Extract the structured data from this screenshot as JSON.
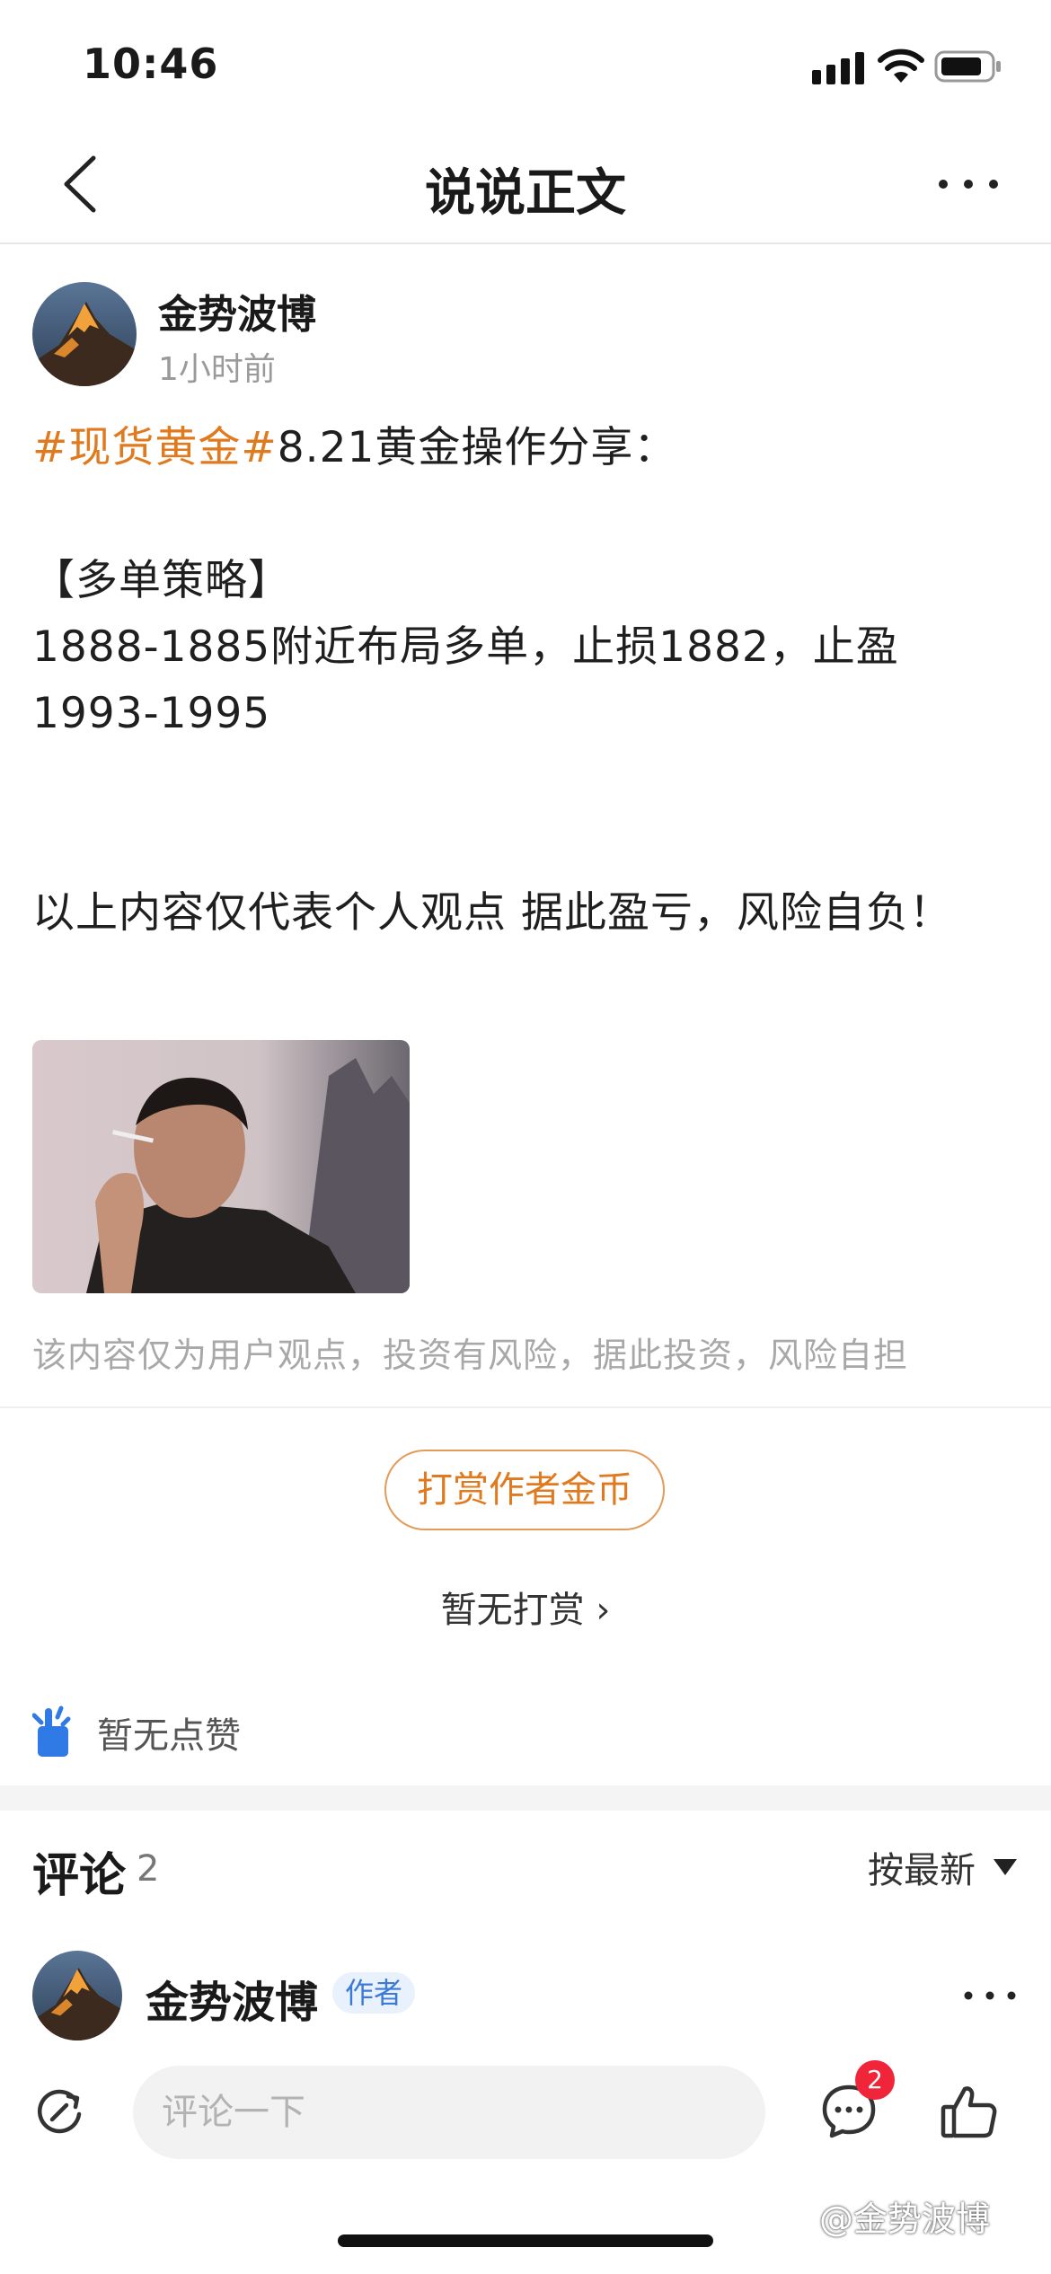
{
  "status_bar": {
    "time": "10:46"
  },
  "nav": {
    "title": "说说正文"
  },
  "post": {
    "author": "金势波博",
    "time": "1小时前",
    "tag": "#现货黄金#",
    "headline": "8.21黄金操作分享：",
    "section_title": "【多单策略】",
    "strategy": "1888-1885附近布局多单，止损1882，止盈1993-1995",
    "note": "以上内容仅代表个人观点 据此盈亏，风险自负！",
    "disclaimer": "该内容仅为用户观点，投资有风险，据此投资，风险自担"
  },
  "reward": {
    "button_label": "打赏作者金币",
    "status": "暂无打赏 ›"
  },
  "likes": {
    "label": "暂无点赞"
  },
  "comments": {
    "title": "评论",
    "count": "2",
    "sort": "按最新",
    "items": [
      {
        "author": "金势波博",
        "badge": "作者"
      }
    ]
  },
  "bottom_bar": {
    "input_placeholder": "评论一下",
    "comment_badge": "2"
  },
  "watermark": "@金势波博",
  "colors": {
    "accent_orange": "#e07a1f",
    "badge_blue": "#3b7bd6",
    "like_blue": "#2f7ae5",
    "badge_red": "#f0253a"
  }
}
